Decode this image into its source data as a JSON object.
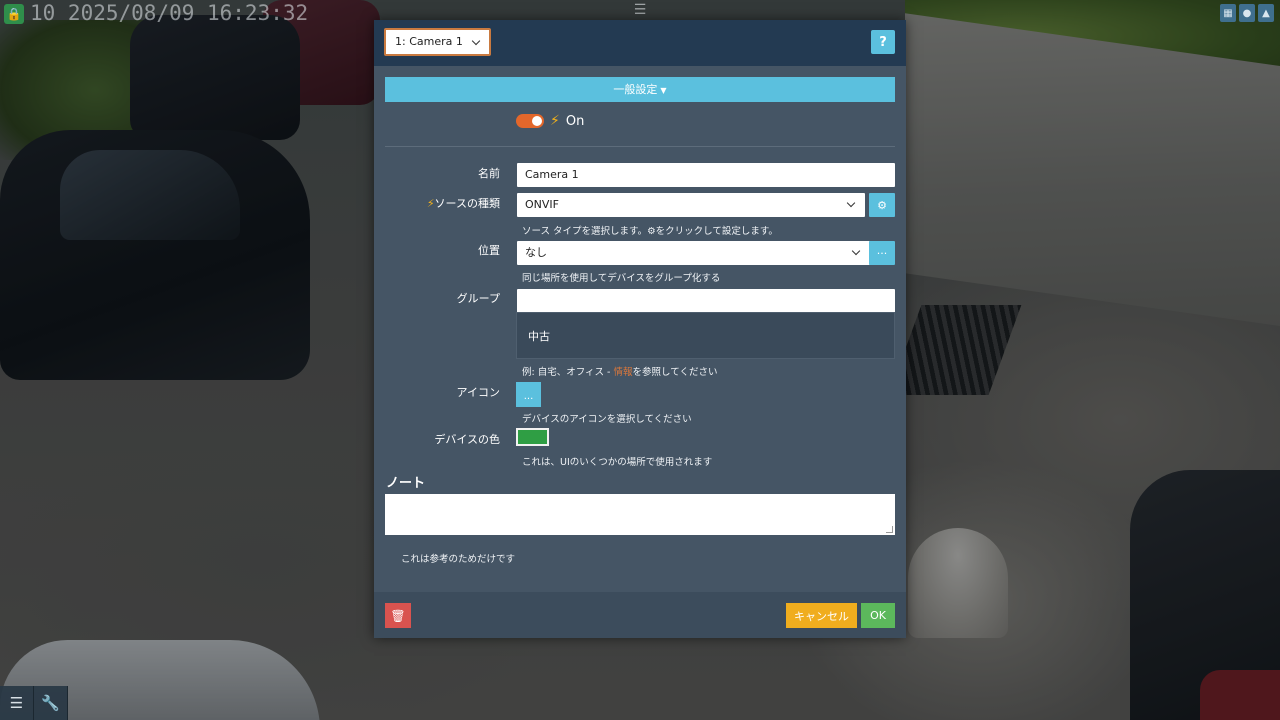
{
  "overlay": {
    "timestamp": "10 2025/08/09 16:23:32"
  },
  "dialog": {
    "camera_select": "1: Camera 1",
    "help_label": "?",
    "section_label": "一般設定",
    "toggle_label": "On",
    "fields": {
      "name_label": "名前",
      "name_value": "Camera 1",
      "source_label": "ソースの種類",
      "source_value": "ONVIF",
      "source_hint_pre": "ソース タイプを選択します。",
      "source_hint_post": "をクリックして設定します。",
      "location_label": "位置",
      "location_value": "なし",
      "location_btn": "···",
      "location_hint": "同じ場所を使用してデバイスをグループ化する",
      "group_label": "グループ",
      "group_value": "",
      "group_suggestion": "中古",
      "group_hint_pre": "例: 自宅、オフィス - ",
      "group_hint_link": "情報",
      "group_hint_post": "を参照してください",
      "icon_label": "アイコン",
      "icon_btn": "...",
      "icon_hint": "デバイスのアイコンを選択してください",
      "color_label": "デバイスの色",
      "color_value": "#2f9e44",
      "color_hint": "これは、UIのいくつかの場所で使用されます"
    },
    "note_title": "ノート",
    "note_value": "",
    "note_hint": "これは参考のためだけです",
    "footer": {
      "cancel_label": "キャンセル",
      "ok_label": "OK"
    }
  },
  "colors": {
    "header": "#233a52",
    "panel": "#455565",
    "accent": "#5bc0de",
    "toggle": "#e3672b",
    "cancel": "#f0ad1e",
    "ok": "#5cb85c",
    "delete": "#d9534f"
  },
  "icons": [
    "lock-icon",
    "menu-icon",
    "layout-icon",
    "user-icon",
    "bell-icon",
    "sliders-icon",
    "wrench-icon",
    "bolt-icon",
    "gears-icon",
    "trash-icon"
  ]
}
